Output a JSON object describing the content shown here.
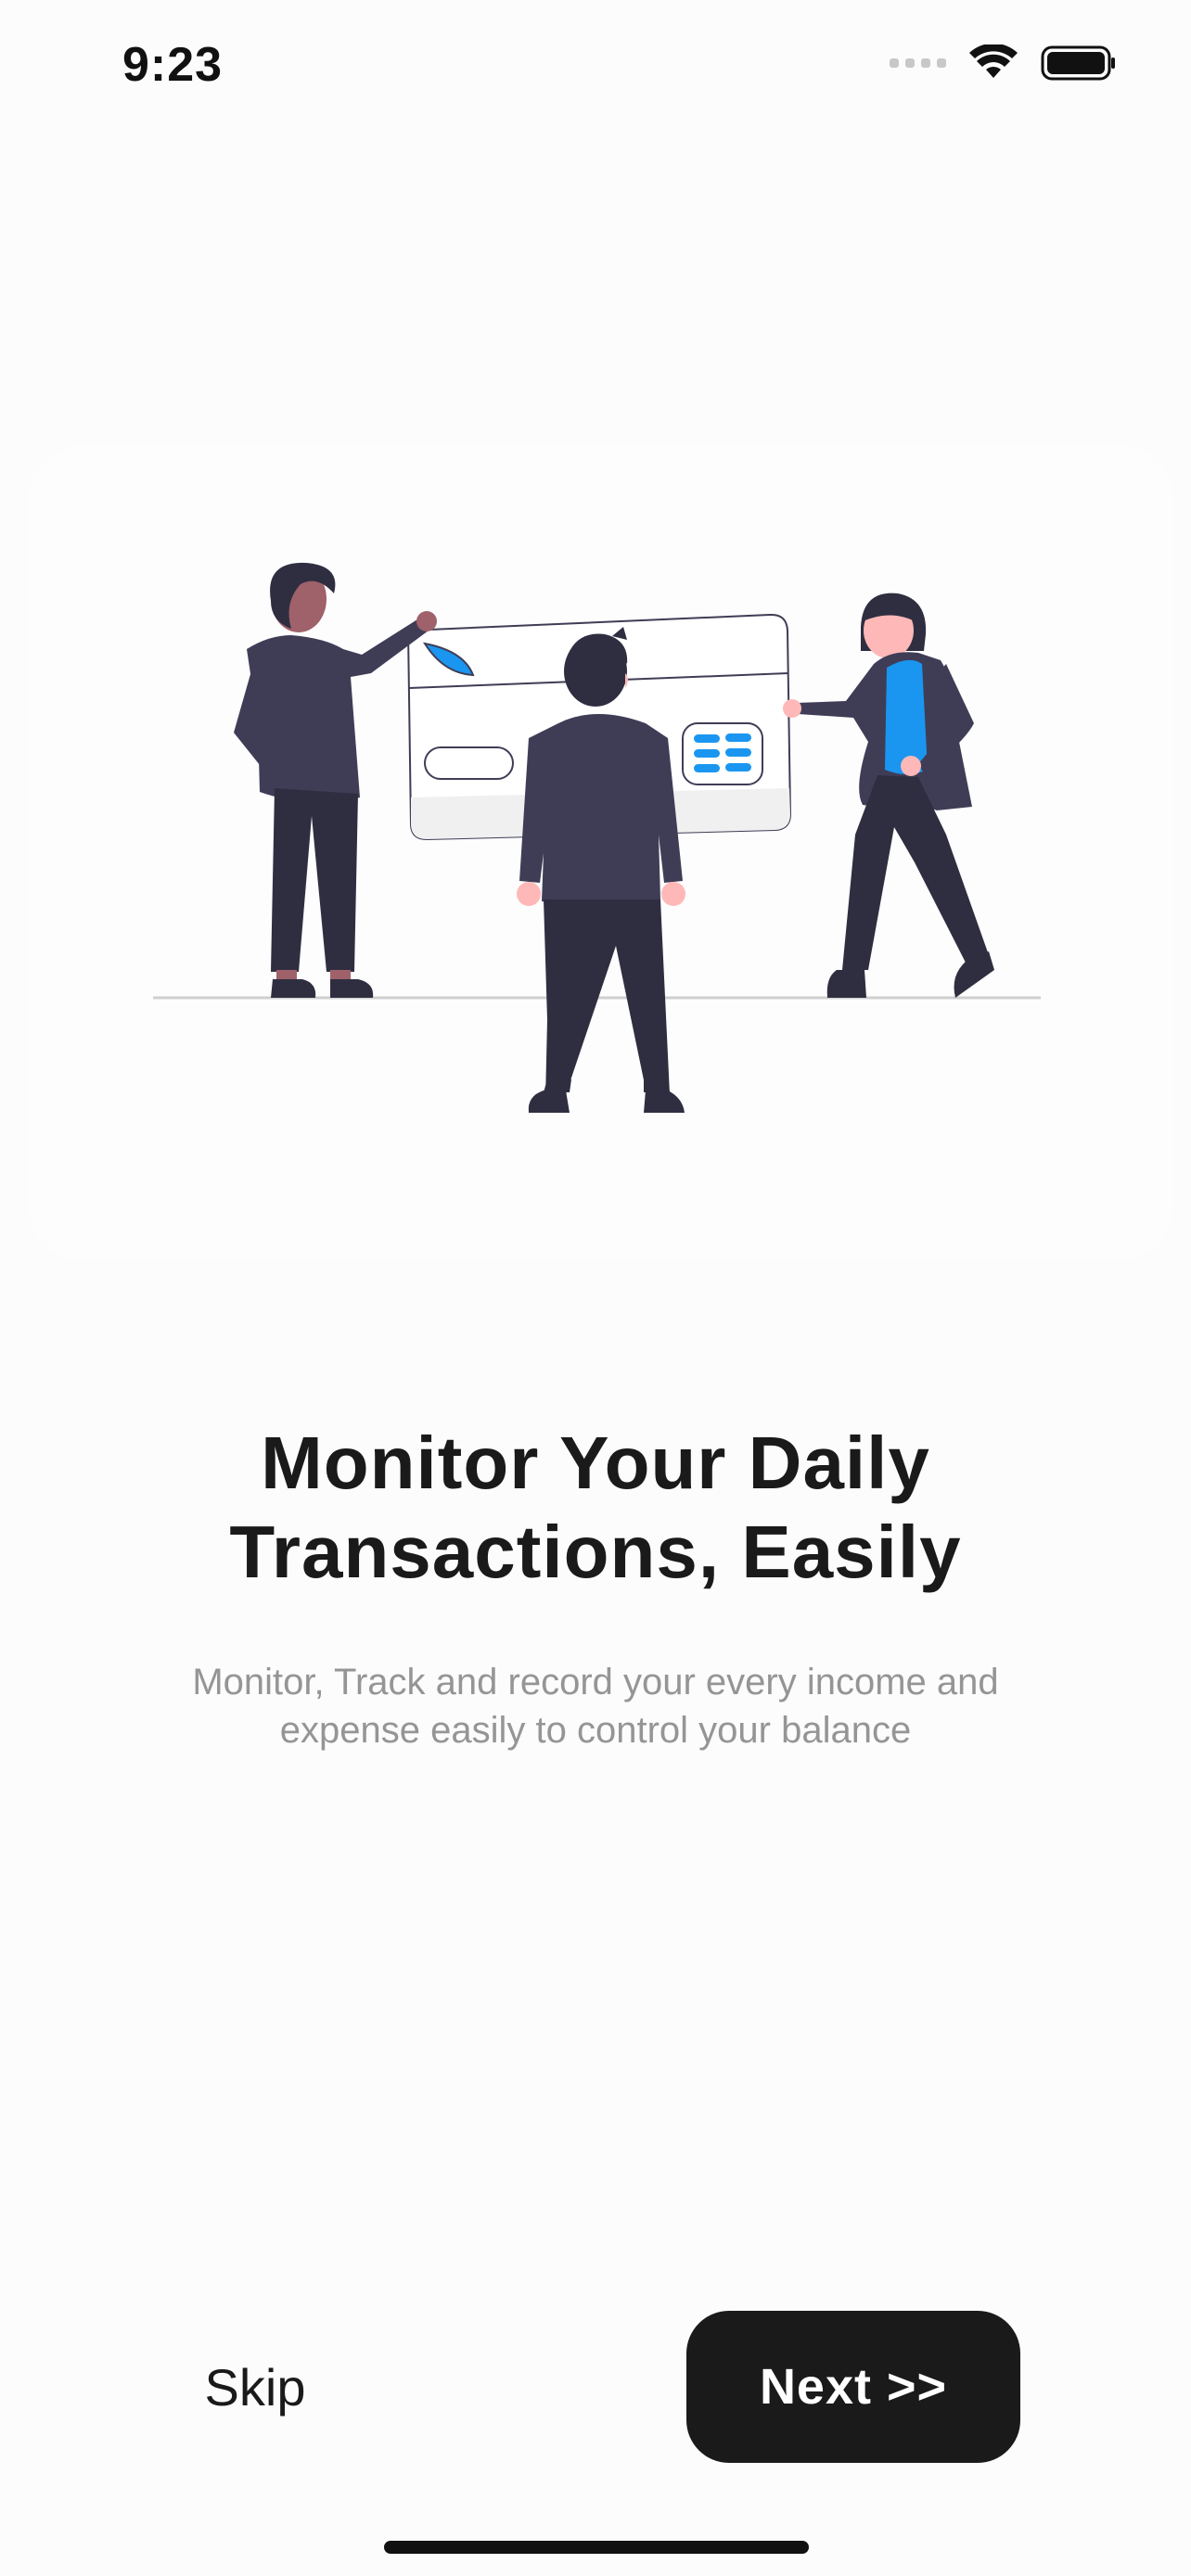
{
  "status_bar": {
    "time": "9:23"
  },
  "onboarding": {
    "title_line1": "Monitor Your Daily",
    "title_line2": "Transactions, Easily",
    "subtitle_line1": "Monitor, Track and record your every income and",
    "subtitle_line2": "expense easily to control your balance"
  },
  "actions": {
    "skip_label": "Skip",
    "next_label": "Next >>"
  },
  "icons": {
    "signal": "cellular-signal-icon",
    "wifi": "wifi-icon",
    "battery": "battery-icon"
  },
  "colors": {
    "accent": "#1a96f0",
    "dark_figure": "#3f3d56",
    "dark_pants": "#2f2e41",
    "button_bg": "#1a1a1a",
    "subtitle": "#959595"
  }
}
